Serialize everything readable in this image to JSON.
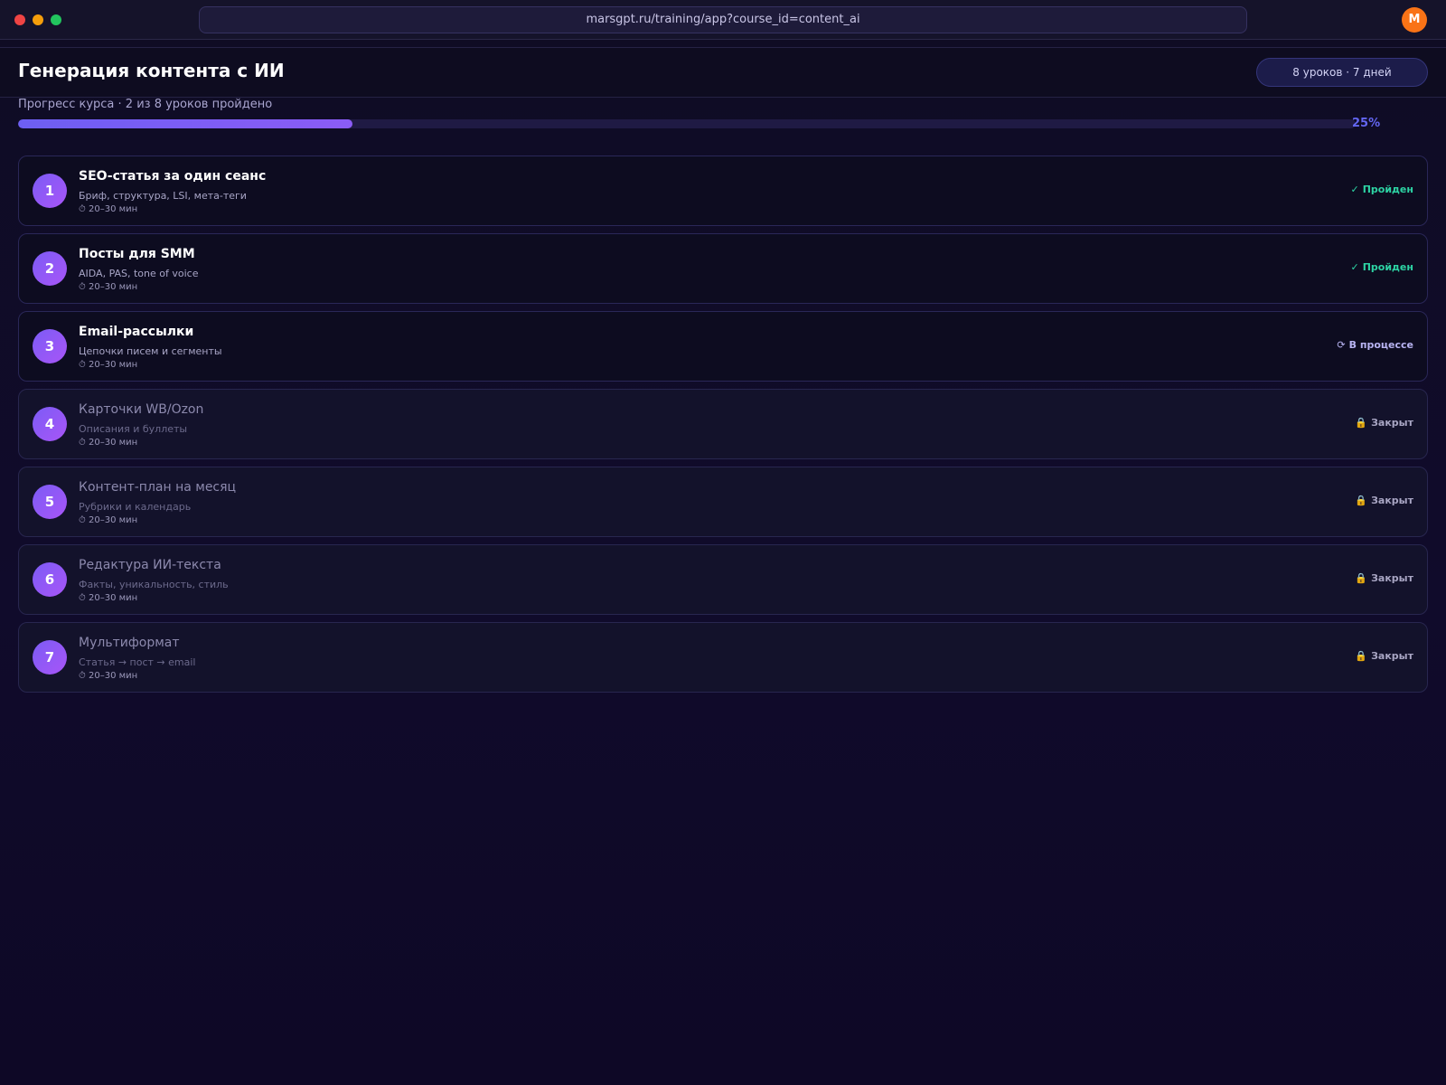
{
  "browser": {
    "url": "marsgpt.ru/training/app?course_id=content_ai",
    "avatar_initial": "M"
  },
  "course": {
    "title": "Генерация контента с ИИ",
    "meta": "8 уроков · 7 дней"
  },
  "progress": {
    "label": "Прогресс курса · 2 из 8 уроков пройдено",
    "percent_text": "25%",
    "fraction": 0.25
  },
  "colors": {
    "accent": "#8b5cf6",
    "done": "#2dd4a4",
    "avatar": "#f97316"
  },
  "lessons": [
    {
      "num": "1",
      "title": "SEO-статья за один сеанс",
      "subtitle": "Бриф, структура, LSI, мета-теги",
      "duration": "⏱ 20–30 мин",
      "status": "done",
      "status_icon": "✓",
      "status_label": "Пройден"
    },
    {
      "num": "2",
      "title": "Посты для SMM",
      "subtitle": "AIDA, PAS, tone of voice",
      "duration": "⏱ 20–30 мин",
      "status": "done",
      "status_icon": "✓",
      "status_label": "Пройден"
    },
    {
      "num": "3",
      "title": "Email-рассылки",
      "subtitle": "Цепочки писем и сегменты",
      "duration": "⏱ 20–30 мин",
      "status": "progress",
      "status_icon": "⟳",
      "status_label": "В процессе"
    },
    {
      "num": "4",
      "title": "Карточки WB/Ozon",
      "subtitle": "Описания и буллеты",
      "duration": "⏱ 20–30 мин",
      "status": "locked",
      "status_icon": "🔒",
      "status_label": "Закрыт"
    },
    {
      "num": "5",
      "title": "Контент-план на месяц",
      "subtitle": "Рубрики и календарь",
      "duration": "⏱ 20–30 мин",
      "status": "locked",
      "status_icon": "🔒",
      "status_label": "Закрыт"
    },
    {
      "num": "6",
      "title": "Редактура ИИ-текста",
      "subtitle": "Факты, уникальность, стиль",
      "duration": "⏱ 20–30 мин",
      "status": "locked",
      "status_icon": "🔒",
      "status_label": "Закрыт"
    },
    {
      "num": "7",
      "title": "Мультиформат",
      "subtitle": "Статья → пост → email",
      "duration": "⏱ 20–30 мин",
      "status": "locked",
      "status_icon": "🔒",
      "status_label": "Закрыт"
    }
  ]
}
